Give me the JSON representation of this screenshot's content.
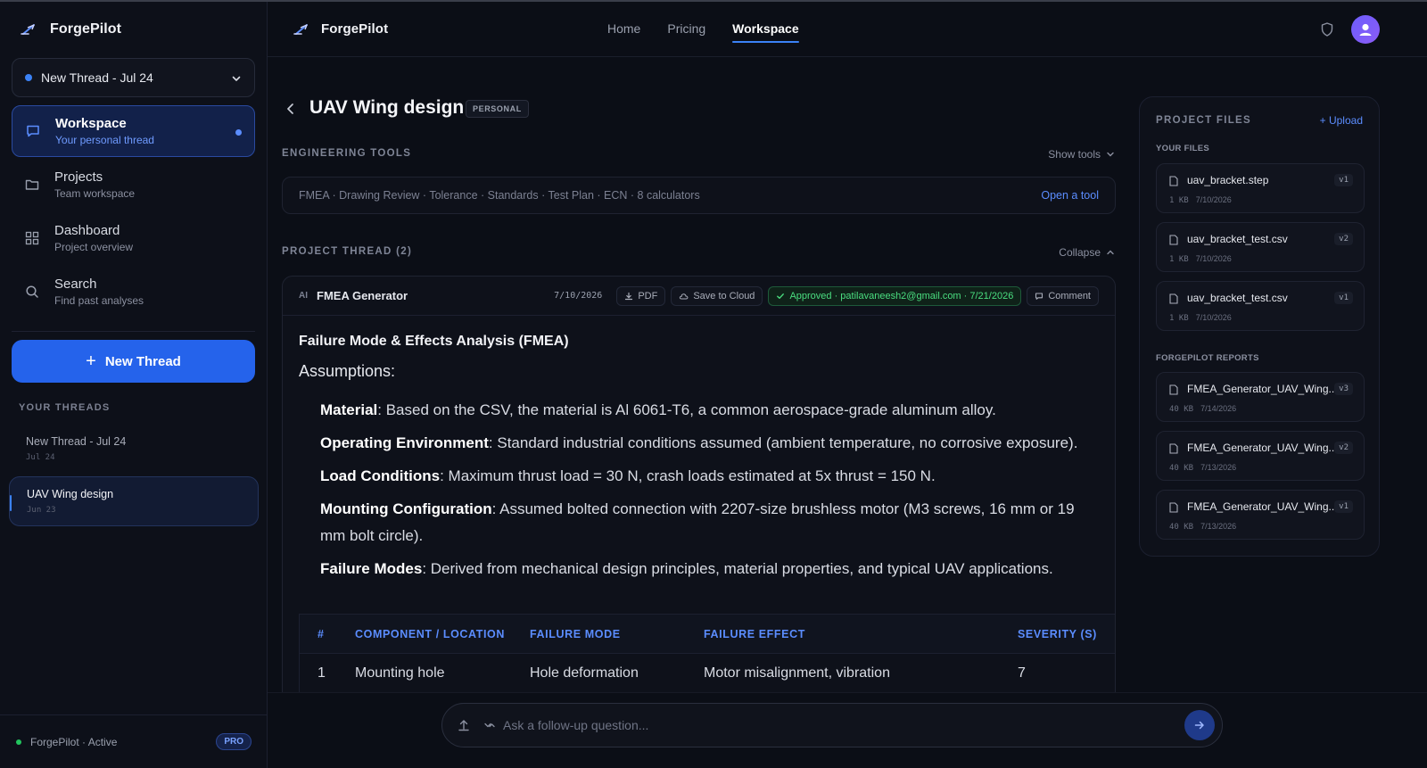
{
  "app": {
    "name": "ForgePilot"
  },
  "sidebar": {
    "thread_select": "New Thread - Jul 24",
    "nav": [
      {
        "title": "Workspace",
        "sub": "Your personal thread"
      },
      {
        "title": "Projects",
        "sub": "Team workspace"
      },
      {
        "title": "Dashboard",
        "sub": "Project overview"
      },
      {
        "title": "Search",
        "sub": "Find past analyses"
      }
    ],
    "new_thread": "New Thread",
    "threads_label": "YOUR THREADS",
    "threads": [
      {
        "name": "New Thread - Jul 24",
        "date": "Jul 24"
      },
      {
        "name": "UAV Wing design",
        "date": "Jun 23"
      }
    ],
    "footer_status": "ForgePilot · Active",
    "footer_badge": "PRO"
  },
  "header": {
    "nav": [
      "Home",
      "Pricing",
      "Workspace"
    ]
  },
  "project": {
    "title": "UAV Wing design",
    "badge": "PERSONAL"
  },
  "tools": {
    "label": "ENGINEERING TOOLS",
    "toggle": "Show tools",
    "list": "FMEA · Drawing Review · Tolerance · Standards · Test Plan · ECN · 8 calculators",
    "link": "Open a tool"
  },
  "thread": {
    "label": "PROJECT THREAD (2)",
    "toggle": "Collapse",
    "card": {
      "ai": "AI",
      "title": "FMEA Generator",
      "date": "7/10/2026",
      "pdf": "PDF",
      "save": "Save to Cloud",
      "approved": "Approved · patilavaneesh2@gmail.com · 7/21/2026",
      "comment": "Comment",
      "heading": "Failure Mode & Effects Analysis (FMEA)",
      "assumptions_label": "Assumptions:",
      "assumptions": [
        {
          "k": "Material",
          "v": ": Based on the CSV, the material is Al 6061-T6, a common aerospace-grade aluminum alloy."
        },
        {
          "k": "Operating Environment",
          "v": ": Standard industrial conditions assumed (ambient temperature, no corrosive exposure)."
        },
        {
          "k": "Load Conditions",
          "v": ": Maximum thrust load = 30 N, crash loads estimated at 5x thrust = 150 N."
        },
        {
          "k": "Mounting Configuration",
          "v": ": Assumed bolted connection with 2207-size brushless motor (M3 screws, 16 mm or 19 mm bolt circle)."
        },
        {
          "k": "Failure Modes",
          "v": ": Derived from mechanical design principles, material properties, and typical UAV applications."
        }
      ],
      "table": {
        "headers": [
          "#",
          "COMPONENT / LOCATION",
          "FAILURE MODE",
          "FAILURE EFFECT",
          "SEVERITY (S)"
        ],
        "rows": [
          [
            "1",
            "Mounting hole",
            "Hole deformation",
            "Motor misalignment, vibration",
            "7"
          ]
        ]
      }
    }
  },
  "files": {
    "title": "PROJECT FILES",
    "upload": "+ Upload",
    "your_files_label": "YOUR FILES",
    "your_files": [
      {
        "name": "uav_bracket.step",
        "ver": "v1",
        "size": "1 KB",
        "date": "7/10/2026"
      },
      {
        "name": "uav_bracket_test.csv",
        "ver": "v2",
        "size": "1 KB",
        "date": "7/10/2026"
      },
      {
        "name": "uav_bracket_test.csv",
        "ver": "v1",
        "size": "1 KB",
        "date": "7/10/2026"
      }
    ],
    "reports_label": "FORGEPILOT REPORTS",
    "reports": [
      {
        "name": "FMEA_Generator_UAV_Wing...",
        "ver": "v3",
        "size": "40 KB",
        "date": "7/14/2026"
      },
      {
        "name": "FMEA_Generator_UAV_Wing...",
        "ver": "v2",
        "size": "40 KB",
        "date": "7/13/2026"
      },
      {
        "name": "FMEA_Generator_UAV_Wing...",
        "ver": "v1",
        "size": "40 KB",
        "date": "7/13/2026"
      }
    ]
  },
  "input": {
    "placeholder": "Ask a follow-up question..."
  },
  "colors": {
    "accent": "#2563eb",
    "approved": "#4ade80",
    "bg": "#0b0e16"
  }
}
